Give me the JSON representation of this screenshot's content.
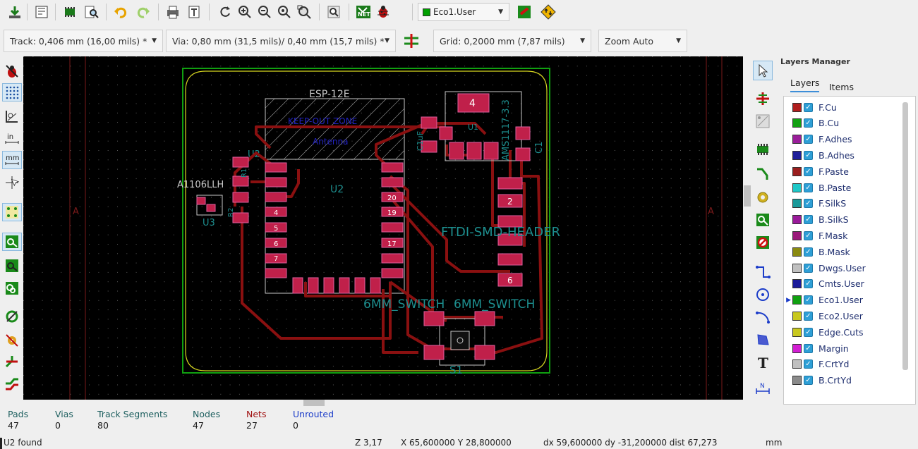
{
  "toolbar": {
    "icons": [
      "save-board-icon",
      "page-settings-icon",
      "footprint-editor-icon",
      "footprint-browser-icon",
      "undo-icon",
      "redo-icon",
      "print-icon",
      "plot-icon",
      "redraw-icon",
      "zoom-in-icon",
      "zoom-out-icon",
      "zoom-fit-icon",
      "zoom-selection-icon",
      "find-icon",
      "netlist-icon",
      "drc-icon",
      "layer-pair-icon",
      "autoroute-icon"
    ],
    "active_layer": "Eco1.User",
    "active_layer_color": "#00a000"
  },
  "options_bar": {
    "track": "Track: 0,406 mm (16,00 mils) *",
    "via": "Via: 0,80 mm (31,5 mils)/ 0,40 mm (15,7 mils) *",
    "grid": "Grid: 0,2000 mm (7,87 mils)",
    "zoom": "Zoom Auto"
  },
  "canvas": {
    "silkscreen_texts": {
      "esp": "ESP-12E",
      "keepout": "KEEP-OUT ZONE",
      "antenna": "Antenna",
      "u2_ref": "U2",
      "u2_center": "U2",
      "a1106": "A1106LLH",
      "u3": "U3",
      "r1": "R1",
      "r2": "R2",
      "u1": "U1",
      "ams": "AMS1117-3.3",
      "c1": "C1",
      "c1uf": "C1uF",
      "ftdi": "FTDI-SMD-HEADER",
      "switch_a": "6MM_SWITCH",
      "switch_b": "6MM_SWITCH",
      "s1": "S1",
      "ua": "A",
      "ub": "A"
    },
    "pads_left": [
      "4",
      "5",
      "6",
      "7"
    ],
    "pads_right": [
      "20",
      "19",
      "17"
    ],
    "ftdi_pads": [
      "2",
      "6"
    ],
    "ams_pad": "4"
  },
  "layers_manager": {
    "title": "Layers Manager",
    "tabs": [
      "Layers",
      "Items"
    ],
    "layers": [
      {
        "name": "F.Cu",
        "color": "#b01e1e"
      },
      {
        "name": "B.Cu",
        "color": "#12a012"
      },
      {
        "name": "F.Adhes",
        "color": "#9a1e9a"
      },
      {
        "name": "B.Adhes",
        "color": "#1e1e9a"
      },
      {
        "name": "F.Paste",
        "color": "#9a1e1e"
      },
      {
        "name": "B.Paste",
        "color": "#1ec8c8"
      },
      {
        "name": "F.SilkS",
        "color": "#1a9a9a"
      },
      {
        "name": "B.SilkS",
        "color": "#9a1a9a"
      },
      {
        "name": "F.Mask",
        "color": "#9a1a7a"
      },
      {
        "name": "B.Mask",
        "color": "#8a8a10"
      },
      {
        "name": "Dwgs.User",
        "color": "#c0c0c0"
      },
      {
        "name": "Cmts.User",
        "color": "#1a1a9a"
      },
      {
        "name": "Eco1.User",
        "color": "#10a010"
      },
      {
        "name": "Eco2.User",
        "color": "#c8c81e"
      },
      {
        "name": "Edge.Cuts",
        "color": "#c8c81e"
      },
      {
        "name": "Margin",
        "color": "#d21ed2"
      },
      {
        "name": "F.CrtYd",
        "color": "#c0c0c0"
      },
      {
        "name": "B.CrtYd",
        "color": "#8a8a8a"
      }
    ],
    "active_layer": "Eco1.User"
  },
  "stats": {
    "pads_label": "Pads",
    "pads": "47",
    "vias_label": "Vias",
    "vias": "0",
    "tracks_label": "Track Segments",
    "tracks": "80",
    "nodes_label": "Nodes",
    "nodes": "47",
    "nets_label": "Nets",
    "nets": "27",
    "unrouted_label": "Unrouted",
    "unrouted": "0"
  },
  "status": {
    "message": "U2 found",
    "zoom": "Z 3,17",
    "xy": "X 65,600000  Y 28,800000",
    "delta": "dx 59,600000  dy -31,200000  dist 67,273",
    "units": "mm"
  }
}
